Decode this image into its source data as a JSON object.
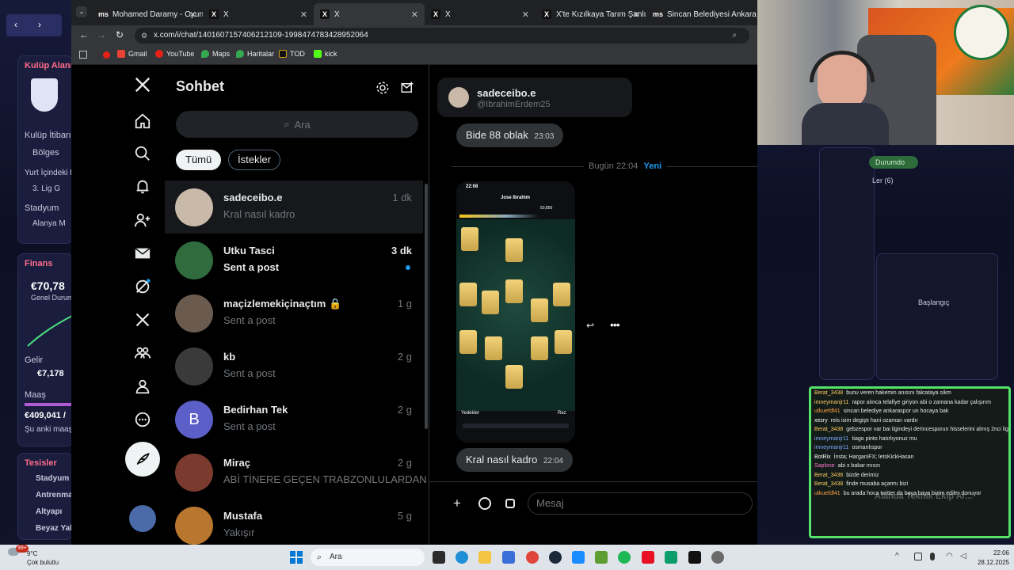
{
  "game": {
    "club_panel_title": "Kulüp Alanı",
    "club_reputation_label": "Kulüp İtibarı",
    "club_reputation_value": "Bölges",
    "domestic_label": "Yurt İçindeki K",
    "domestic_value": "3. Lig G",
    "stadium_label": "Stadyum",
    "stadium_value": "Alanya M",
    "finance_title": "Finans",
    "finance_amount": "€70,78",
    "finance_sub": "Genel Durum",
    "income_label": "Gelir",
    "income_value": "€7,178",
    "salary_label": "Maaş",
    "salary_value": "€409,041 /",
    "salary_sub": "Şu anki maaş",
    "facilities_title": "Tesisler",
    "facilities": [
      "Stadyum",
      "Antrenma",
      "Altyapı",
      "Beyaz Yak"
    ],
    "right_badge": "Durumdo",
    "right_text": "Ler (6)",
    "right_label": "Başlangıç",
    "faded_text": "Alanda Teknik Ekip Ar..."
  },
  "browser": {
    "tabs": [
      {
        "title": "Mohamed Daramy - Oyun",
        "icon": "ms"
      },
      {
        "title": "X",
        "icon": "X"
      },
      {
        "title": "X",
        "icon": "X"
      },
      {
        "title": "X",
        "icon": "X"
      },
      {
        "title": "X'te Kızılkaya Tarım Şanlı",
        "icon": "X"
      },
      {
        "title": "Sincan Belediyesi Ankara",
        "icon": "ms"
      }
    ],
    "url": "x.com/i/chat/1401607157406212109-1998474783428952064",
    "bookmarks": [
      "Gmail",
      "YouTube",
      "Maps",
      "Haritalar",
      "TOD",
      "kick"
    ]
  },
  "x": {
    "list_title": "Sohbet",
    "search_placeholder": "Ara",
    "filters": [
      "Tümü",
      "İstekler"
    ],
    "conversations": [
      {
        "name": "sadeceibo.e",
        "preview": "Kral nasıl kadro",
        "time": "1 dk",
        "bold": false,
        "avatar_color": "#c9b9a8"
      },
      {
        "name": "Utku Tasci",
        "preview": "Sent a post",
        "time": "3 dk",
        "bold": true,
        "avatar_color": "#2f6b3d"
      },
      {
        "name": "maçizlemekiçinaçtım 🔒",
        "preview": "Sent a post",
        "time": "1 g",
        "bold": false,
        "avatar_color": "#6b5a4e"
      },
      {
        "name": "kb",
        "preview": "Sent a post",
        "time": "2 g",
        "bold": false,
        "avatar_color": "#3a3a3a"
      },
      {
        "name": "Bedirhan Tek",
        "preview": "Sent a post",
        "time": "2 g",
        "bold": false,
        "avatar_color": "#5b5fc7",
        "initial": "B"
      },
      {
        "name": "Miraç",
        "preview": "ABİ TİNERE GEÇEN TRABZONLULARDAN",
        "time": "2 g",
        "bold": false,
        "avatar_color": "#7a3b2e"
      },
      {
        "name": "Mustafa",
        "preview": "Yakışır",
        "time": "5 g",
        "bold": false,
        "avatar_color": "#b8762e"
      }
    ],
    "chat": {
      "name": "sadeceibo.e",
      "handle": "@IbrahimErdem25",
      "msg1": "Bide 88 oblak",
      "msg1_time": "23:03",
      "divider_day": "Bugün",
      "divider_time": "22:04",
      "divider_new": "Yeni",
      "msg2": "Kral nasıl kadro",
      "msg2_time": "22:04",
      "composer_placeholder": "Mesaj",
      "shot": {
        "time": "22:08",
        "player": "Jose Ibrahim",
        "coins": "50,850",
        "subs": "Yedekler",
        "bench": "Rez"
      }
    }
  },
  "stream_chat": [
    {
      "user": "Berat_3438",
      "msg": "bunu veren hakemin anısını falcataya sikm",
      "color": "#ffcc66"
    },
    {
      "user": "imneymanjr11",
      "msg": "rapor alınca telafiye giriyon abi o zamana kadar çalışırım",
      "color": "#ffcc66"
    },
    {
      "user": "utkuefdf41",
      "msg": "sincan belediye ankaraspor un hocaya bak",
      "color": "#ff9f43"
    },
    {
      "user": "xezry",
      "msg": "reis isim degiştı hani ozaman vardır",
      "color": "#ffffff"
    },
    {
      "user": "Berat_3438",
      "msg": "gebzespor var bai ilgindeyi derincesporun hisselerini almış 2nci ligden basladılar isim degistirip",
      "color": "#ffcc66"
    },
    {
      "user": "imneymanjr11",
      "msg": "tiago pinto hatırlıyonuz mu",
      "color": "#7fa7ff"
    },
    {
      "user": "imneymanjr11",
      "msg": "osmanlıspor",
      "color": "#7fa7ff"
    },
    {
      "user": "BotRix",
      "msg": "İnsta; HarganiFX; letsKickHasan",
      "color": "#ffffff"
    },
    {
      "user": "Saplone",
      "msg": "abi x bakar mısın",
      "color": "#ff77cc"
    },
    {
      "user": "Berat_3438",
      "msg": "bizde derimiz",
      "color": "#ffcc66"
    },
    {
      "user": "Berat_3438",
      "msg": "finde musaba açarmı bizi",
      "color": "#ffcc66"
    },
    {
      "user": "utkuefdf41",
      "msg": "bu arada hoca twitter da baya baya bizim ediler donuyor",
      "color": "#ff9f43"
    }
  ],
  "taskbar": {
    "weather_temp": "9°C",
    "weather_desc": "Çok bulutlu",
    "search_placeholder": "Ara",
    "time": "22:06",
    "date": "28.12.2025",
    "notif": "99+"
  }
}
